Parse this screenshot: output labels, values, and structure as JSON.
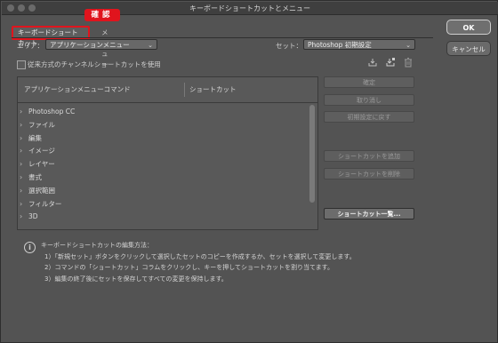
{
  "window": {
    "title": "キーボードショートカットとメニュー"
  },
  "badge": "確認",
  "tabs": [
    {
      "label": "キーボードショートカット"
    },
    {
      "label": "メニュー"
    }
  ],
  "area": {
    "label": "エリア：",
    "value": "アプリケーションメニュー"
  },
  "set": {
    "label": "セット：",
    "value": "Photoshop 初期設定"
  },
  "legacy_checkbox": {
    "label": "従来方式のチャンネルショートカットを使用",
    "checked": false
  },
  "toolbar_icons": [
    "save-set-icon",
    "save-as-set-icon",
    "delete-set-icon"
  ],
  "table": {
    "headers": [
      "アプリケーションメニューコマンド",
      "ショートカット"
    ],
    "rows": [
      "Photoshop CC",
      "ファイル",
      "編集",
      "イメージ",
      "レイヤー",
      "書式",
      "選択範囲",
      "フィルター",
      "3D"
    ]
  },
  "right_buttons": {
    "accept": "確定",
    "undo": "取り消し",
    "use_default": "初期設定に戻す",
    "add_shortcut": "ショートカットを追加",
    "delete_shortcut": "ショートカットを削除",
    "summarize": "ショートカット一覧..."
  },
  "dialog_buttons": {
    "ok": "OK",
    "cancel": "キャンセル"
  },
  "info": {
    "heading": "キーボードショートカットの編集方法：",
    "lines": [
      "1）「新規セット」ボタンをクリックして選択したセットのコピーを作成するか、セットを選択して変更します。",
      "2）コマンドの「ショートカット」コラムをクリックし、キーを押してショートカットを割り当てます。",
      "3）編集の終了後にセットを保存してすべての変更を保持します。"
    ]
  }
}
